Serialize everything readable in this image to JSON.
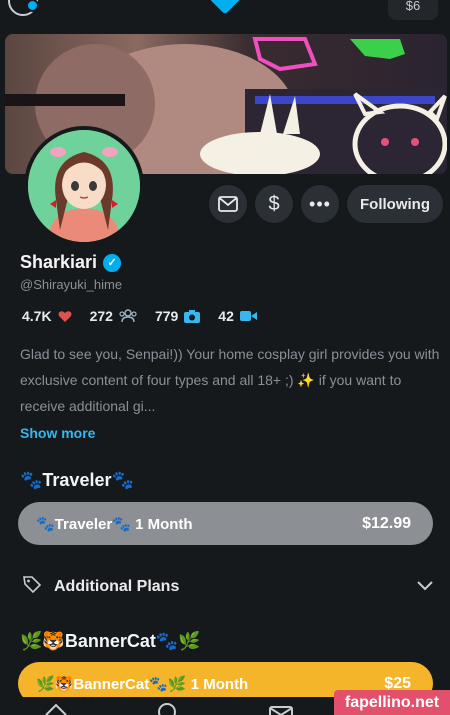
{
  "topbar": {
    "right_label": "$6"
  },
  "profile": {
    "name": "Sharkiari",
    "handle": "@Shirayuki_hime",
    "following_label": "Following"
  },
  "stats": {
    "likes": "4.7K",
    "fans": "272",
    "photos": "779",
    "videos": "42"
  },
  "bio": {
    "text": "Glad to see you, Senpai!)) Your home cosplay girl provides you with exclusive content of four types and all 18+ ;) ✨ if you want to receive additional gi...",
    "show_more": "Show more"
  },
  "subscriptions": [
    {
      "title": "🐾Traveler🐾",
      "button_name": "🐾Traveler🐾",
      "duration": "1 Month",
      "price": "$12.99",
      "color": "#8c8f93"
    },
    {
      "title": "🌿🐯BannerCat🐾🌿",
      "button_name": "🌿🐯BannerCat🐾🌿",
      "duration": "1 Month",
      "price": "$25",
      "color": "#f4b52a"
    }
  ],
  "additional_plans_label": "Additional Plans",
  "watermark": "fapellino.net",
  "colors": {
    "accent": "#00aff0",
    "background": "#16191c",
    "like": "#e0504f"
  }
}
